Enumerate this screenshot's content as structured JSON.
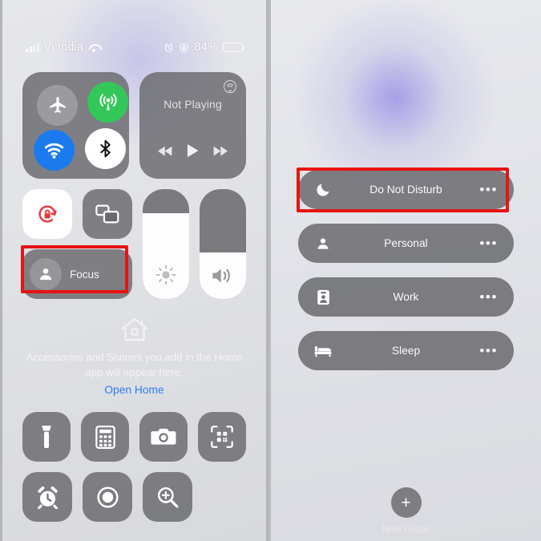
{
  "statusbar": {
    "carrier": "Vi India",
    "battery_percent": "84%",
    "battery_level": 84,
    "icons": [
      "cellular-signal-icon",
      "wifi-icon",
      "alarm-icon",
      "rotation-lock-icon",
      "battery-icon"
    ]
  },
  "control_center": {
    "connectivity": {
      "airplane_mode": "airplane-mode-icon",
      "cellular_data": "cellular-data-icon",
      "wifi": "wifi-icon",
      "bluetooth": "bluetooth-icon"
    },
    "media": {
      "title": "Not Playing",
      "airplay": "airplay-icon",
      "rewind": "rewind-icon",
      "play": "play-icon",
      "forward": "fast-forward-icon"
    },
    "orientation_lock": "rotation-lock-icon",
    "screen_mirroring": "screen-mirroring-icon",
    "focus": {
      "label": "Focus",
      "icon": "person-icon"
    },
    "brightness": {
      "icon": "brightness-icon",
      "value": 78
    },
    "volume": {
      "icon": "volume-icon",
      "value": 42
    },
    "home": {
      "icon": "home-icon",
      "message": "Accessories and Scenes you add in the Home app will appear here.",
      "link": "Open Home"
    },
    "apps": [
      {
        "name": "flashlight-icon"
      },
      {
        "name": "calculator-icon"
      },
      {
        "name": "camera-icon"
      },
      {
        "name": "qr-code-scanner-icon"
      },
      {
        "name": "alarm-clock-icon"
      },
      {
        "name": "screen-record-icon"
      },
      {
        "name": "magnifier-icon"
      }
    ]
  },
  "focus_panel": {
    "modes": [
      {
        "label": "Do Not Disturb",
        "icon": "moon-icon",
        "more": "•••",
        "highlighted": true
      },
      {
        "label": "Personal",
        "icon": "person-icon",
        "more": "•••",
        "highlighted": false
      },
      {
        "label": "Work",
        "icon": "work-badge-icon",
        "more": "•••",
        "highlighted": false
      },
      {
        "label": "Sleep",
        "icon": "bed-icon",
        "more": "•••",
        "highlighted": false
      }
    ],
    "new_focus": {
      "label": "New Focus",
      "icon": "plus-icon"
    }
  },
  "annotations": {
    "highlight_color": "#e81313",
    "boxes": [
      "focus-button-highlight",
      "do-not-disturb-highlight"
    ]
  }
}
